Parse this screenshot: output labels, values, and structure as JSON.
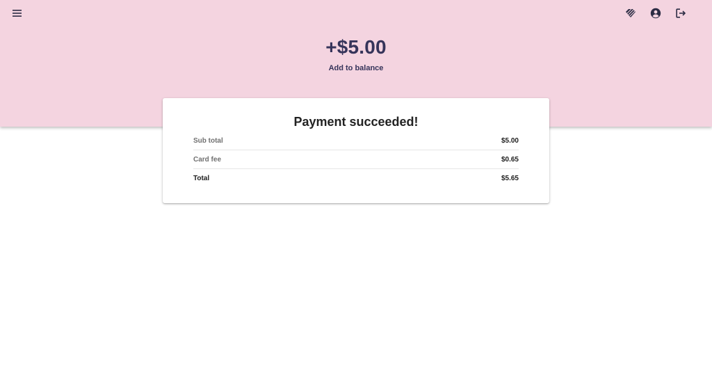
{
  "header": {
    "amount": "+$5.00",
    "subtitle": "Add to balance",
    "icons": {
      "menu": "menu-icon",
      "diamond": "diamond-icon",
      "account": "account-circle-icon",
      "logout": "logout-icon"
    },
    "background_color": "#f4d4e0",
    "text_color": "#36345a"
  },
  "receipt": {
    "title": "Payment succeeded!",
    "rows": [
      {
        "label": "Sub total",
        "value": "$5.00"
      },
      {
        "label": "Card fee",
        "value": "$0.65"
      },
      {
        "label": "Total",
        "value": "$5.65"
      }
    ]
  }
}
